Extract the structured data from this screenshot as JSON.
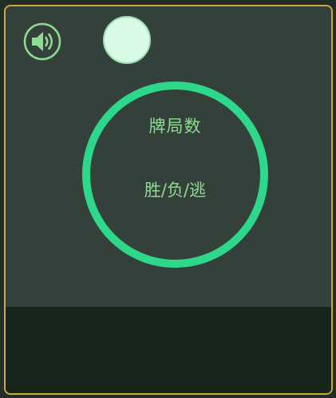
{
  "sound": {
    "icon": "speaker-volume-icon"
  },
  "player": {
    "avatar_color": "#d9fbe6"
  },
  "stats": {
    "games_label": "牌局数",
    "record_label": "胜/负/逃",
    "ring_color": "#2ed88a"
  },
  "theme": {
    "panel_bg": "#34413a",
    "border": "#c9a93c",
    "bottom_bg": "#17251a",
    "text": "#8ddc93"
  }
}
